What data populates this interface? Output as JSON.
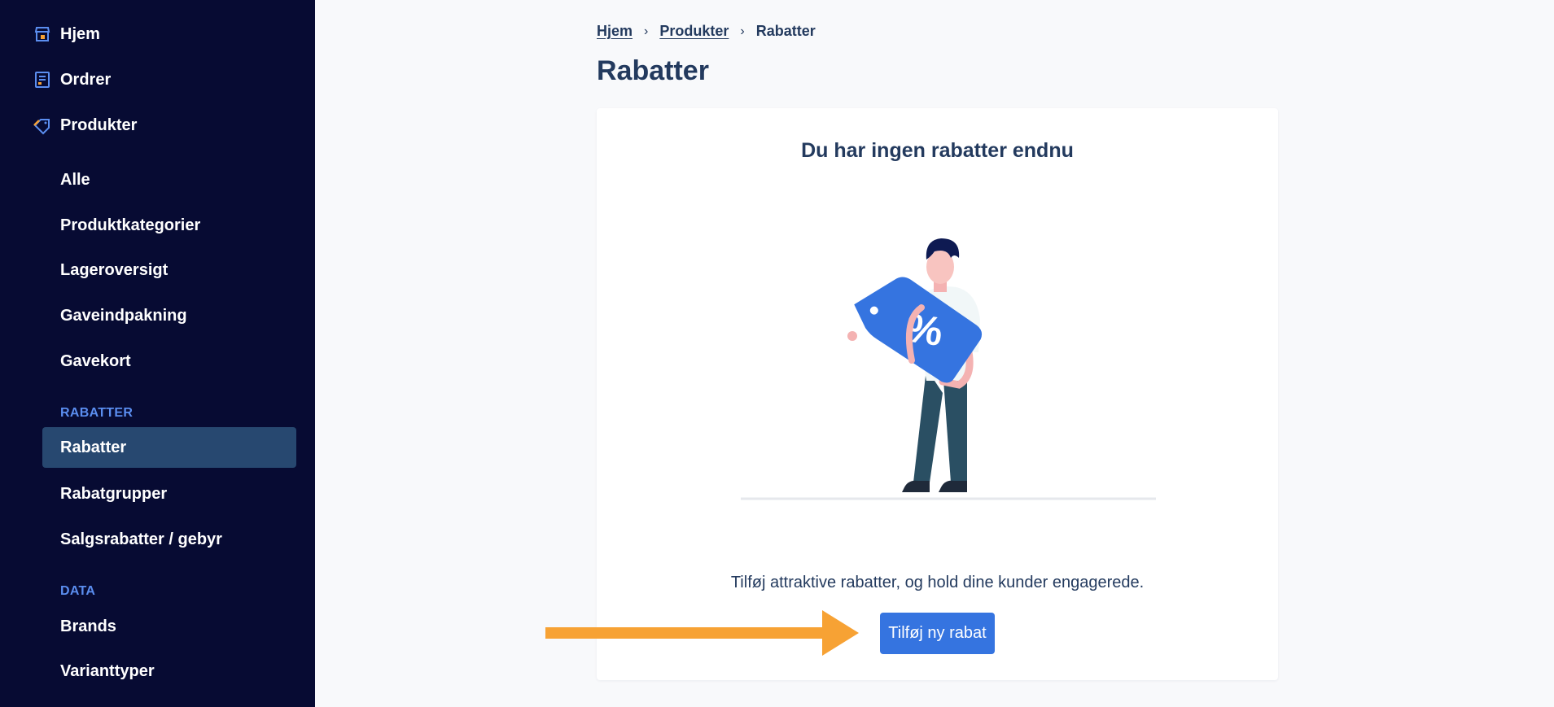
{
  "sidebar": {
    "top_items": [
      {
        "label": "Hjem",
        "icon": "store-icon"
      },
      {
        "label": "Ordrer",
        "icon": "orders-icon"
      },
      {
        "label": "Produkter",
        "icon": "tag-icon"
      }
    ],
    "product_items": [
      "Alle",
      "Produktkategorier",
      "Lageroversigt",
      "Gaveindpakning",
      "Gavekort"
    ],
    "discount_section": "RABATTER",
    "discount_items": [
      "Rabatter",
      "Rabatgrupper",
      "Salgsrabatter / gebyr"
    ],
    "data_section": "DATA",
    "data_items": [
      "Brands",
      "Varianttyper"
    ]
  },
  "breadcrumb": {
    "items": [
      "Hjem",
      "Produkter"
    ],
    "current": "Rabatter"
  },
  "page_title": "Rabatter",
  "empty_state": {
    "title": "Du har ingen rabatter endnu",
    "description": "Tilføj attraktive rabatter, og hold dine kunder engagerede.",
    "button_label": "Tilføj ny rabat"
  },
  "colors": {
    "sidebar_bg": "#070b33",
    "active_item_bg": "#274870",
    "accent": "#3574e0",
    "arrow": "#f7a234",
    "section_label": "#5b8ef0"
  }
}
